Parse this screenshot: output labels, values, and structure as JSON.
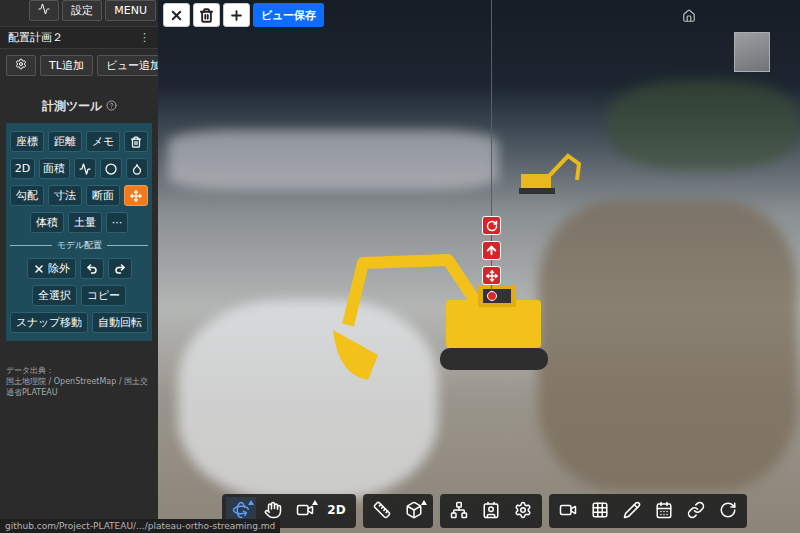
{
  "sidebar": {
    "top_buttons": [
      {
        "kind": "icon"
      },
      {
        "kind": "text",
        "label": "設定"
      },
      {
        "kind": "text",
        "label": "MENU"
      }
    ],
    "plan": {
      "title": "配置計画２",
      "menu": "⋮"
    },
    "actions": [
      {
        "kind": "icon"
      },
      {
        "kind": "text",
        "label": "TL追加"
      },
      {
        "kind": "text",
        "label": "ビュー追加"
      }
    ],
    "section_title": "計測ツール",
    "tool_rows": [
      [
        {
          "kind": "text",
          "label": "座標",
          "selected": false
        },
        {
          "kind": "text",
          "label": "距離",
          "selected": false
        },
        {
          "kind": "text",
          "label": "メモ",
          "selected": false
        },
        {
          "kind": "icon",
          "selected": false
        }
      ],
      [
        {
          "kind": "text",
          "label": "2D",
          "selected": false
        },
        {
          "kind": "text",
          "label": "面積",
          "selected": false
        },
        {
          "kind": "icon",
          "selected": false
        },
        {
          "kind": "icon",
          "selected": false
        },
        {
          "kind": "icon",
          "selected": false
        }
      ],
      [
        {
          "kind": "text",
          "label": "勾配",
          "selected": false
        },
        {
          "kind": "text",
          "label": "寸法",
          "selected": false
        },
        {
          "kind": "text",
          "label": "断面",
          "selected": false
        },
        {
          "kind": "icon",
          "selected": true
        }
      ],
      [
        {
          "kind": "text",
          "label": "体積",
          "selected": false
        },
        {
          "kind": "text",
          "label": "土量",
          "selected": false
        },
        {
          "kind": "text",
          "label": "···",
          "selected": false
        }
      ]
    ],
    "model_section": "モデル配置",
    "model_rows": [
      [
        {
          "kind": "iconlabel",
          "label": "除外"
        },
        {
          "kind": "icon"
        },
        {
          "kind": "icon"
        }
      ],
      [
        {
          "kind": "text",
          "label": "全選択"
        },
        {
          "kind": "text",
          "label": "コピー"
        }
      ],
      [
        {
          "kind": "text",
          "label": "スナップ移動"
        },
        {
          "kind": "text",
          "label": "自動回転"
        }
      ]
    ],
    "credit": {
      "label": "データ出典：",
      "sources": "国土地理院 / OpenStreetMap / 国土交通省PLATEAU"
    }
  },
  "top_toolbar": [
    {
      "kind": "icon"
    },
    {
      "kind": "icon"
    },
    {
      "kind": "icon"
    },
    {
      "kind": "text",
      "label": "ビュー保存"
    }
  ],
  "bottom_toolbar": [
    [
      {
        "kind": "icon",
        "selected": true,
        "menu": true
      },
      {
        "kind": "icon",
        "selected": false,
        "menu": false
      },
      {
        "kind": "icon",
        "selected": false,
        "menu": true
      },
      {
        "kind": "text",
        "label": "2D",
        "selected": false,
        "menu": false
      }
    ],
    [
      {
        "kind": "icon",
        "selected": false,
        "menu": false
      },
      {
        "kind": "icon",
        "selected": false,
        "menu": true
      }
    ],
    [
      {
        "kind": "icon",
        "selected": false,
        "menu": false
      },
      {
        "kind": "icon",
        "selected": false,
        "menu": false
      },
      {
        "kind": "icon",
        "selected": false,
        "menu": false
      }
    ],
    [
      {
        "kind": "icon",
        "selected": false,
        "menu": false
      },
      {
        "kind": "icon",
        "selected": false,
        "menu": false
      },
      {
        "kind": "icon",
        "selected": false,
        "menu": false
      },
      {
        "kind": "icon",
        "selected": false,
        "menu": false
      },
      {
        "kind": "icon",
        "selected": false,
        "menu": false
      },
      {
        "kind": "icon",
        "selected": false,
        "menu": false
      }
    ]
  ],
  "status_url": "github.com/Project-PLATEAU/.../plateau-ortho-streaming.md"
}
